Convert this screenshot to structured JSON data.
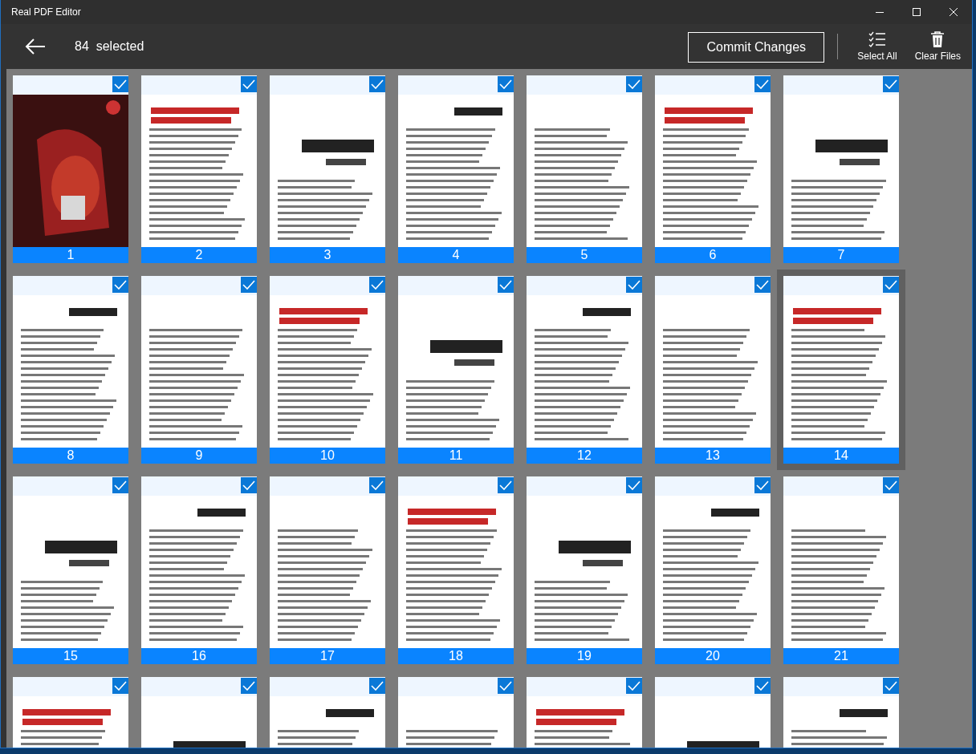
{
  "window": {
    "title": "Real PDF Editor"
  },
  "toolbar": {
    "selection_count": "84",
    "selection_label": "selected",
    "commit_button": "Commit Changes",
    "select_all": "Select All",
    "clear_files": "Clear Files"
  },
  "pages": [
    {
      "label": "1",
      "selected": true,
      "focused": false
    },
    {
      "label": "2",
      "selected": true,
      "focused": false
    },
    {
      "label": "3",
      "selected": true,
      "focused": false
    },
    {
      "label": "4",
      "selected": true,
      "focused": false
    },
    {
      "label": "5",
      "selected": true,
      "focused": false
    },
    {
      "label": "6",
      "selected": true,
      "focused": false
    },
    {
      "label": "7",
      "selected": true,
      "focused": false
    },
    {
      "label": "8",
      "selected": true,
      "focused": false
    },
    {
      "label": "9",
      "selected": true,
      "focused": false
    },
    {
      "label": "10",
      "selected": true,
      "focused": false
    },
    {
      "label": "11",
      "selected": true,
      "focused": false
    },
    {
      "label": "12",
      "selected": true,
      "focused": false
    },
    {
      "label": "13",
      "selected": true,
      "focused": false
    },
    {
      "label": "14",
      "selected": true,
      "focused": true
    },
    {
      "label": "15",
      "selected": true,
      "focused": false
    },
    {
      "label": "16",
      "selected": true,
      "focused": false
    },
    {
      "label": "17",
      "selected": true,
      "focused": false
    },
    {
      "label": "18",
      "selected": true,
      "focused": false
    },
    {
      "label": "19",
      "selected": true,
      "focused": false
    },
    {
      "label": "20",
      "selected": true,
      "focused": false
    },
    {
      "label": "21",
      "selected": true,
      "focused": false
    },
    {
      "selected": true,
      "focused": false
    },
    {
      "selected": true,
      "focused": false
    },
    {
      "selected": true,
      "focused": false
    },
    {
      "selected": true,
      "focused": false
    },
    {
      "selected": true,
      "focused": false
    },
    {
      "selected": true,
      "focused": false
    },
    {
      "selected": true,
      "focused": false
    }
  ]
}
